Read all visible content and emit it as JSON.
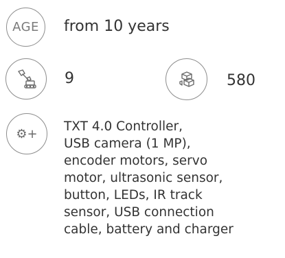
{
  "age": {
    "badge": "AGE",
    "value": "from 10 years"
  },
  "models": {
    "icon": "robot-arm-icon",
    "value": "9"
  },
  "parts": {
    "icon": "building-block-icon",
    "value": "580"
  },
  "components": {
    "icon": "gear-plus-icon",
    "icon_text": "⚙+",
    "value": "TXT 4.0 Controller,\nUSB camera (1 MP),\nencoder motors, servo\nmotor, ultrasonic sensor,\nbutton, LEDs, IR track\nsensor, USB connection\ncable, battery and charger"
  },
  "colors": {
    "icon_stroke": "#8c8c8c",
    "text": "#333333"
  }
}
